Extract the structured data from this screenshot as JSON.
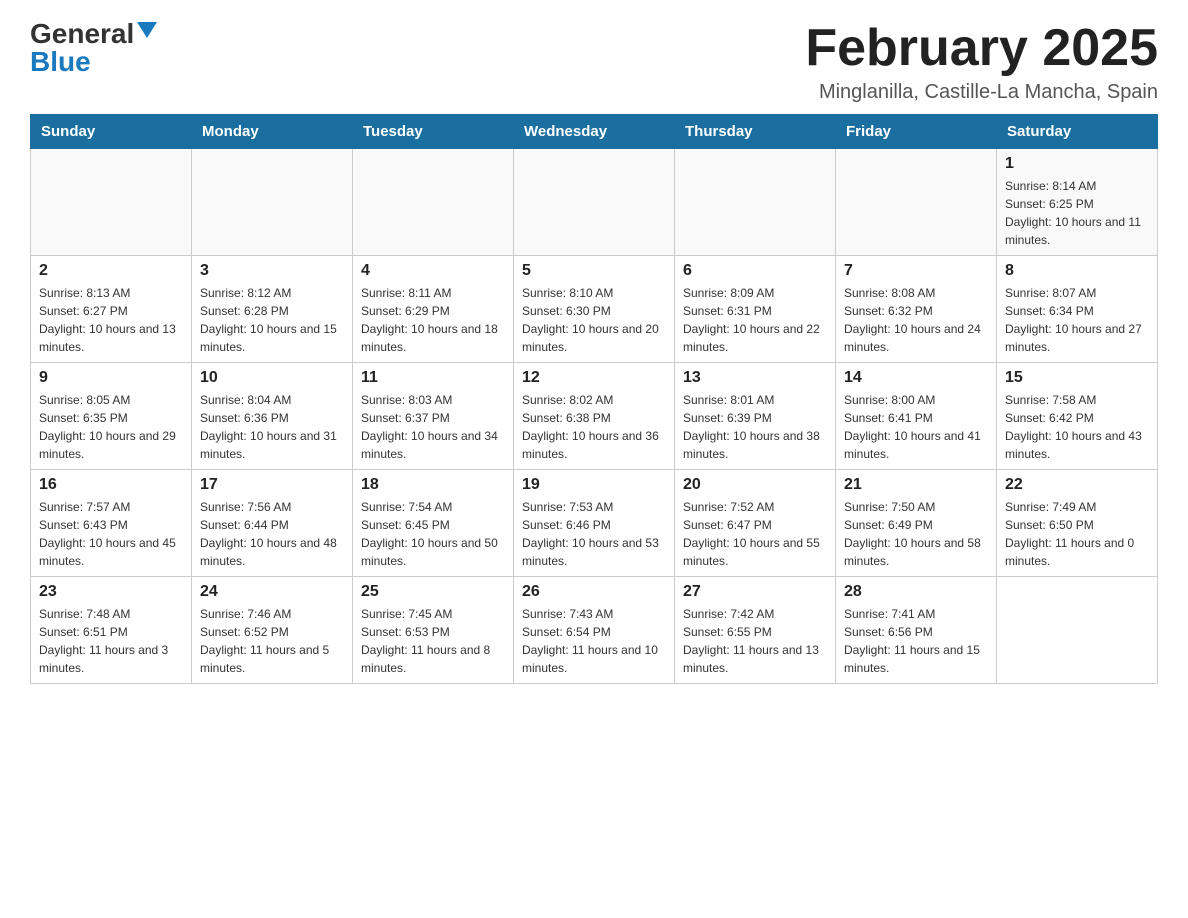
{
  "header": {
    "logo": {
      "general": "General",
      "blue": "Blue",
      "triangle": true
    },
    "title": "February 2025",
    "location": "Minglanilla, Castille-La Mancha, Spain"
  },
  "days_of_week": [
    "Sunday",
    "Monday",
    "Tuesday",
    "Wednesday",
    "Thursday",
    "Friday",
    "Saturday"
  ],
  "weeks": [
    {
      "days": [
        {
          "number": "",
          "info": ""
        },
        {
          "number": "",
          "info": ""
        },
        {
          "number": "",
          "info": ""
        },
        {
          "number": "",
          "info": ""
        },
        {
          "number": "",
          "info": ""
        },
        {
          "number": "",
          "info": ""
        },
        {
          "number": "1",
          "info": "Sunrise: 8:14 AM\nSunset: 6:25 PM\nDaylight: 10 hours and 11 minutes."
        }
      ]
    },
    {
      "days": [
        {
          "number": "2",
          "info": "Sunrise: 8:13 AM\nSunset: 6:27 PM\nDaylight: 10 hours and 13 minutes."
        },
        {
          "number": "3",
          "info": "Sunrise: 8:12 AM\nSunset: 6:28 PM\nDaylight: 10 hours and 15 minutes."
        },
        {
          "number": "4",
          "info": "Sunrise: 8:11 AM\nSunset: 6:29 PM\nDaylight: 10 hours and 18 minutes."
        },
        {
          "number": "5",
          "info": "Sunrise: 8:10 AM\nSunset: 6:30 PM\nDaylight: 10 hours and 20 minutes."
        },
        {
          "number": "6",
          "info": "Sunrise: 8:09 AM\nSunset: 6:31 PM\nDaylight: 10 hours and 22 minutes."
        },
        {
          "number": "7",
          "info": "Sunrise: 8:08 AM\nSunset: 6:32 PM\nDaylight: 10 hours and 24 minutes."
        },
        {
          "number": "8",
          "info": "Sunrise: 8:07 AM\nSunset: 6:34 PM\nDaylight: 10 hours and 27 minutes."
        }
      ]
    },
    {
      "days": [
        {
          "number": "9",
          "info": "Sunrise: 8:05 AM\nSunset: 6:35 PM\nDaylight: 10 hours and 29 minutes."
        },
        {
          "number": "10",
          "info": "Sunrise: 8:04 AM\nSunset: 6:36 PM\nDaylight: 10 hours and 31 minutes."
        },
        {
          "number": "11",
          "info": "Sunrise: 8:03 AM\nSunset: 6:37 PM\nDaylight: 10 hours and 34 minutes."
        },
        {
          "number": "12",
          "info": "Sunrise: 8:02 AM\nSunset: 6:38 PM\nDaylight: 10 hours and 36 minutes."
        },
        {
          "number": "13",
          "info": "Sunrise: 8:01 AM\nSunset: 6:39 PM\nDaylight: 10 hours and 38 minutes."
        },
        {
          "number": "14",
          "info": "Sunrise: 8:00 AM\nSunset: 6:41 PM\nDaylight: 10 hours and 41 minutes."
        },
        {
          "number": "15",
          "info": "Sunrise: 7:58 AM\nSunset: 6:42 PM\nDaylight: 10 hours and 43 minutes."
        }
      ]
    },
    {
      "days": [
        {
          "number": "16",
          "info": "Sunrise: 7:57 AM\nSunset: 6:43 PM\nDaylight: 10 hours and 45 minutes."
        },
        {
          "number": "17",
          "info": "Sunrise: 7:56 AM\nSunset: 6:44 PM\nDaylight: 10 hours and 48 minutes."
        },
        {
          "number": "18",
          "info": "Sunrise: 7:54 AM\nSunset: 6:45 PM\nDaylight: 10 hours and 50 minutes."
        },
        {
          "number": "19",
          "info": "Sunrise: 7:53 AM\nSunset: 6:46 PM\nDaylight: 10 hours and 53 minutes."
        },
        {
          "number": "20",
          "info": "Sunrise: 7:52 AM\nSunset: 6:47 PM\nDaylight: 10 hours and 55 minutes."
        },
        {
          "number": "21",
          "info": "Sunrise: 7:50 AM\nSunset: 6:49 PM\nDaylight: 10 hours and 58 minutes."
        },
        {
          "number": "22",
          "info": "Sunrise: 7:49 AM\nSunset: 6:50 PM\nDaylight: 11 hours and 0 minutes."
        }
      ]
    },
    {
      "days": [
        {
          "number": "23",
          "info": "Sunrise: 7:48 AM\nSunset: 6:51 PM\nDaylight: 11 hours and 3 minutes."
        },
        {
          "number": "24",
          "info": "Sunrise: 7:46 AM\nSunset: 6:52 PM\nDaylight: 11 hours and 5 minutes."
        },
        {
          "number": "25",
          "info": "Sunrise: 7:45 AM\nSunset: 6:53 PM\nDaylight: 11 hours and 8 minutes."
        },
        {
          "number": "26",
          "info": "Sunrise: 7:43 AM\nSunset: 6:54 PM\nDaylight: 11 hours and 10 minutes."
        },
        {
          "number": "27",
          "info": "Sunrise: 7:42 AM\nSunset: 6:55 PM\nDaylight: 11 hours and 13 minutes."
        },
        {
          "number": "28",
          "info": "Sunrise: 7:41 AM\nSunset: 6:56 PM\nDaylight: 11 hours and 15 minutes."
        },
        {
          "number": "",
          "info": ""
        }
      ]
    }
  ]
}
